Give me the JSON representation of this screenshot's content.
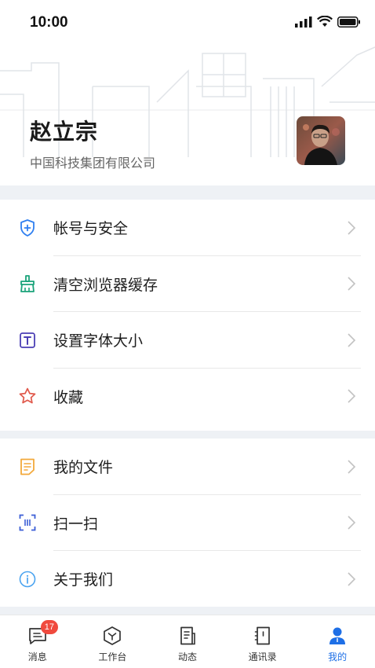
{
  "status_bar": {
    "time": "10:00"
  },
  "profile": {
    "name": "赵立宗",
    "company": "中国科技集团有限公司"
  },
  "menu_group_1": [
    {
      "label": "帐号与安全",
      "icon": "shield-plus-icon",
      "color": "#2f7ff0"
    },
    {
      "label": "清空浏览器缓存",
      "icon": "broom-icon",
      "color": "#1aa37a"
    },
    {
      "label": "设置字体大小",
      "icon": "text-size-icon",
      "color": "#4b3fb5"
    },
    {
      "label": "收藏",
      "icon": "star-icon",
      "color": "#e0584a"
    }
  ],
  "menu_group_2": [
    {
      "label": "我的文件",
      "icon": "document-icon",
      "color": "#f3a93b"
    },
    {
      "label": "扫一扫",
      "icon": "scan-icon",
      "color": "#3c5fd6"
    },
    {
      "label": "关于我们",
      "icon": "info-icon",
      "color": "#4aa3f0"
    }
  ],
  "tabbar": {
    "tabs": [
      {
        "label": "消息",
        "icon": "message-icon",
        "badge": "17"
      },
      {
        "label": "工作台",
        "icon": "workbench-icon"
      },
      {
        "label": "动态",
        "icon": "feed-icon"
      },
      {
        "label": "通讯录",
        "icon": "contacts-icon"
      },
      {
        "label": "我的",
        "icon": "person-icon"
      }
    ],
    "active_index": 4,
    "active_color": "#1e6fe6"
  }
}
